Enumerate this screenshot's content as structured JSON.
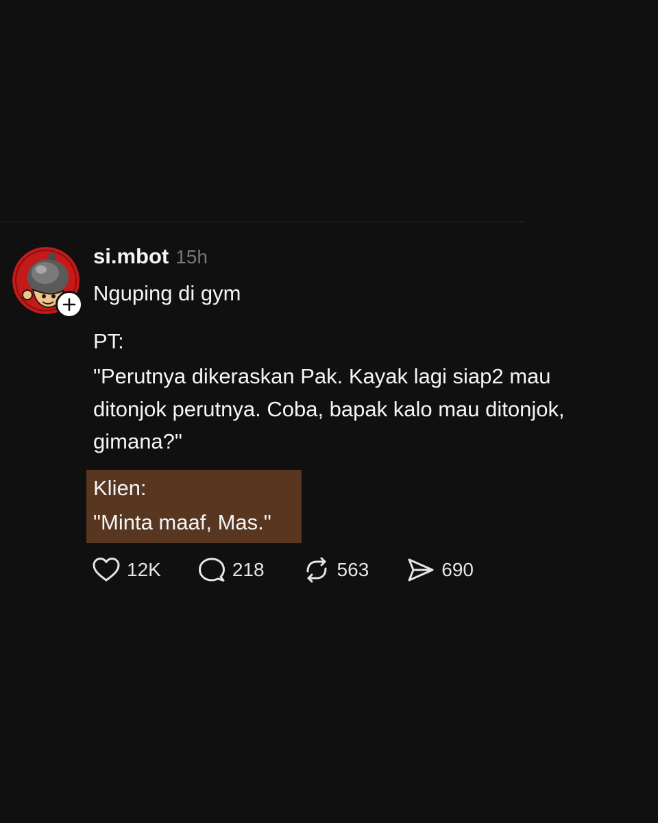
{
  "post": {
    "author": {
      "username": "si.mbot",
      "time_ago": "15h"
    },
    "title_line": "Nguping di gym",
    "body_lines": [
      "PT:",
      "\"Perutnya dikeraskan Pak. Kayak lagi siap2 mau",
      "ditonjok perutnya. Coba, bapak kalo mau ditonjok,",
      "gimana?\""
    ],
    "highlighted_lines": [
      "Klien:",
      "\"Minta maaf, Mas.\""
    ],
    "actions": {
      "likes": {
        "icon": "heart-icon",
        "count": "12K"
      },
      "replies": {
        "icon": "comment-icon",
        "count": "218"
      },
      "reposts": {
        "icon": "repost-icon",
        "count": "563"
      },
      "shares": {
        "icon": "send-icon",
        "count": "690"
      }
    }
  },
  "colors": {
    "background": "#101010",
    "text": "#f3f5f7",
    "muted": "#777777",
    "highlight": "#583620",
    "avatar_red": "#c41a1a"
  }
}
